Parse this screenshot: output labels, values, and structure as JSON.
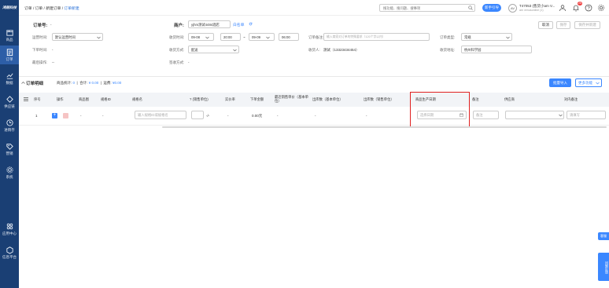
{
  "app": {
    "logo": "鸿鹄科技"
  },
  "sidebar": {
    "items": [
      {
        "label": "商品",
        "icon": "box-icon"
      },
      {
        "label": "订单",
        "icon": "order-icon",
        "active": true
      },
      {
        "label": "数据",
        "icon": "chart-icon"
      },
      {
        "label": "供应链",
        "icon": "supply-chain-icon"
      },
      {
        "label": "进销存",
        "icon": "inventory-icon"
      },
      {
        "label": "营销",
        "icon": "marketing-icon"
      },
      {
        "label": "系统",
        "icon": "gear-icon"
      },
      {
        "label": "应用中心",
        "icon": "apps-icon"
      },
      {
        "label": "信息平台",
        "icon": "platform-icon"
      }
    ]
  },
  "topbar": {
    "breadcrumb": [
      "订单",
      "订单",
      "新建订单",
      "订单新建"
    ],
    "search_placeholder": "搜功能、搜问题、搜事项",
    "new_tab_label": "新手引导",
    "user_avatar_text": "AV",
    "user_name": "T47053 (售货小am V...",
    "user_sub": "am  venusonline  (1)",
    "notification_count": "25"
  },
  "header": {
    "order_no_label": "订单号:",
    "order_no_value": "-",
    "customer_label": "商户:",
    "customer_value": "yjhm测试4484酒店",
    "customer_link": "白名单",
    "cancel_label": "取消",
    "save_label": "保存",
    "save_new_label": "保存并新建",
    "shipping_label": "运营时间:",
    "shipping_value": "默认运营时间",
    "delivery_date_label": "收货时间:",
    "date_start": "09-08",
    "time_start": "20:00",
    "range_sep": "~",
    "date_end": "09-09",
    "time_end": "06:00",
    "order_remark_label": "订单备注:",
    "order_remark_placeholder": "输入商家对订单的特殊要求（120个字以内）",
    "order_type_label": "订单类型:",
    "order_type_value": "常规",
    "order_time_label": "下单时间:",
    "order_time_value": "-",
    "delivery_method_label": "收货方式:",
    "delivery_method_value": "配送",
    "receiver_label": "收货人:",
    "receiver_value": "测试（13323434454）",
    "address_label": "收货地址:",
    "address_value": "杭州科学园",
    "last_op_label": "最后操作:",
    "last_op_value": "--",
    "pay_method_label": "签收方式:",
    "pay_method_value": "-"
  },
  "detail": {
    "title": "订单明细",
    "stats_items_label": "商品统计:",
    "stats_items_value": "0",
    "stats_total_label": "合计:",
    "stats_total_value": "¥ 0.00",
    "stats_freight_label": "运费:",
    "stats_freight_value": "¥0.00",
    "import_label": "批量导入",
    "more_label": "更多功能",
    "columns": [
      "序号",
      "操作",
      "商品图",
      "规格ID",
      "规格名",
      "? (销售单位)",
      "实价率",
      "下单金额",
      "最近销售单价（基本单位）",
      "出库数（基本单位）",
      "出库数（销售单位）",
      "商品生产日期",
      "备注",
      "供应商",
      "对内备注"
    ],
    "row": {
      "index": "1",
      "image": "-",
      "spec_id": "-",
      "spec_name_placeholder": "输入规格ID或规格名",
      "unit_suffix": "-/-",
      "discount": "-",
      "amount": "0.00元",
      "recent_price": "-",
      "out_basic": "-",
      "out_sale": "-",
      "date_placeholder": "选择日期",
      "remark_placeholder": "备注",
      "inner_remark_placeholder": "请填写"
    }
  },
  "side_tabs": {
    "top": "客服",
    "bottom": "问题反馈"
  }
}
